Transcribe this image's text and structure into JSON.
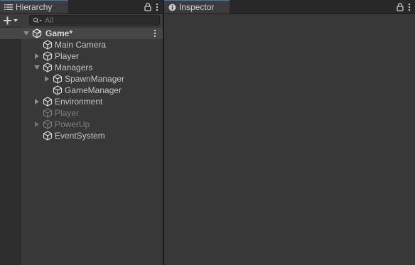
{
  "hierarchy": {
    "tab_label": "Hierarchy",
    "search_placeholder": "All",
    "scene_name": "Game*",
    "items": [
      {
        "label": "Main Camera",
        "depth": 0,
        "fold": "none",
        "dim": false
      },
      {
        "label": "Player",
        "depth": 0,
        "fold": "collapsed",
        "dim": false
      },
      {
        "label": "Managers",
        "depth": 0,
        "fold": "expanded",
        "dim": false
      },
      {
        "label": "SpawnManager",
        "depth": 1,
        "fold": "collapsed",
        "dim": false
      },
      {
        "label": "GameManager",
        "depth": 1,
        "fold": "none",
        "dim": false
      },
      {
        "label": "Environment",
        "depth": 0,
        "fold": "collapsed",
        "dim": false
      },
      {
        "label": "Player",
        "depth": 0,
        "fold": "none",
        "dim": true
      },
      {
        "label": "PowerUp",
        "depth": 0,
        "fold": "collapsed",
        "dim": true
      },
      {
        "label": "EventSystem",
        "depth": 0,
        "fold": "none",
        "dim": false
      }
    ]
  },
  "inspector": {
    "tab_label": "Inspector"
  },
  "icons": {
    "hierarchy_tab": "list-icon",
    "inspector_tab": "info-icon",
    "lock": "lock-icon",
    "menu": "kebab-menu-icon",
    "create": "plus-dropdown-icon",
    "search": "search-icon",
    "scene": "unity-scene-icon",
    "gameobject": "cube-icon"
  },
  "colors": {
    "panel_bg": "#383838",
    "tab_accent": "#3a79bb",
    "text": "#c4c4c4",
    "text_dim": "#7e7e7e"
  }
}
